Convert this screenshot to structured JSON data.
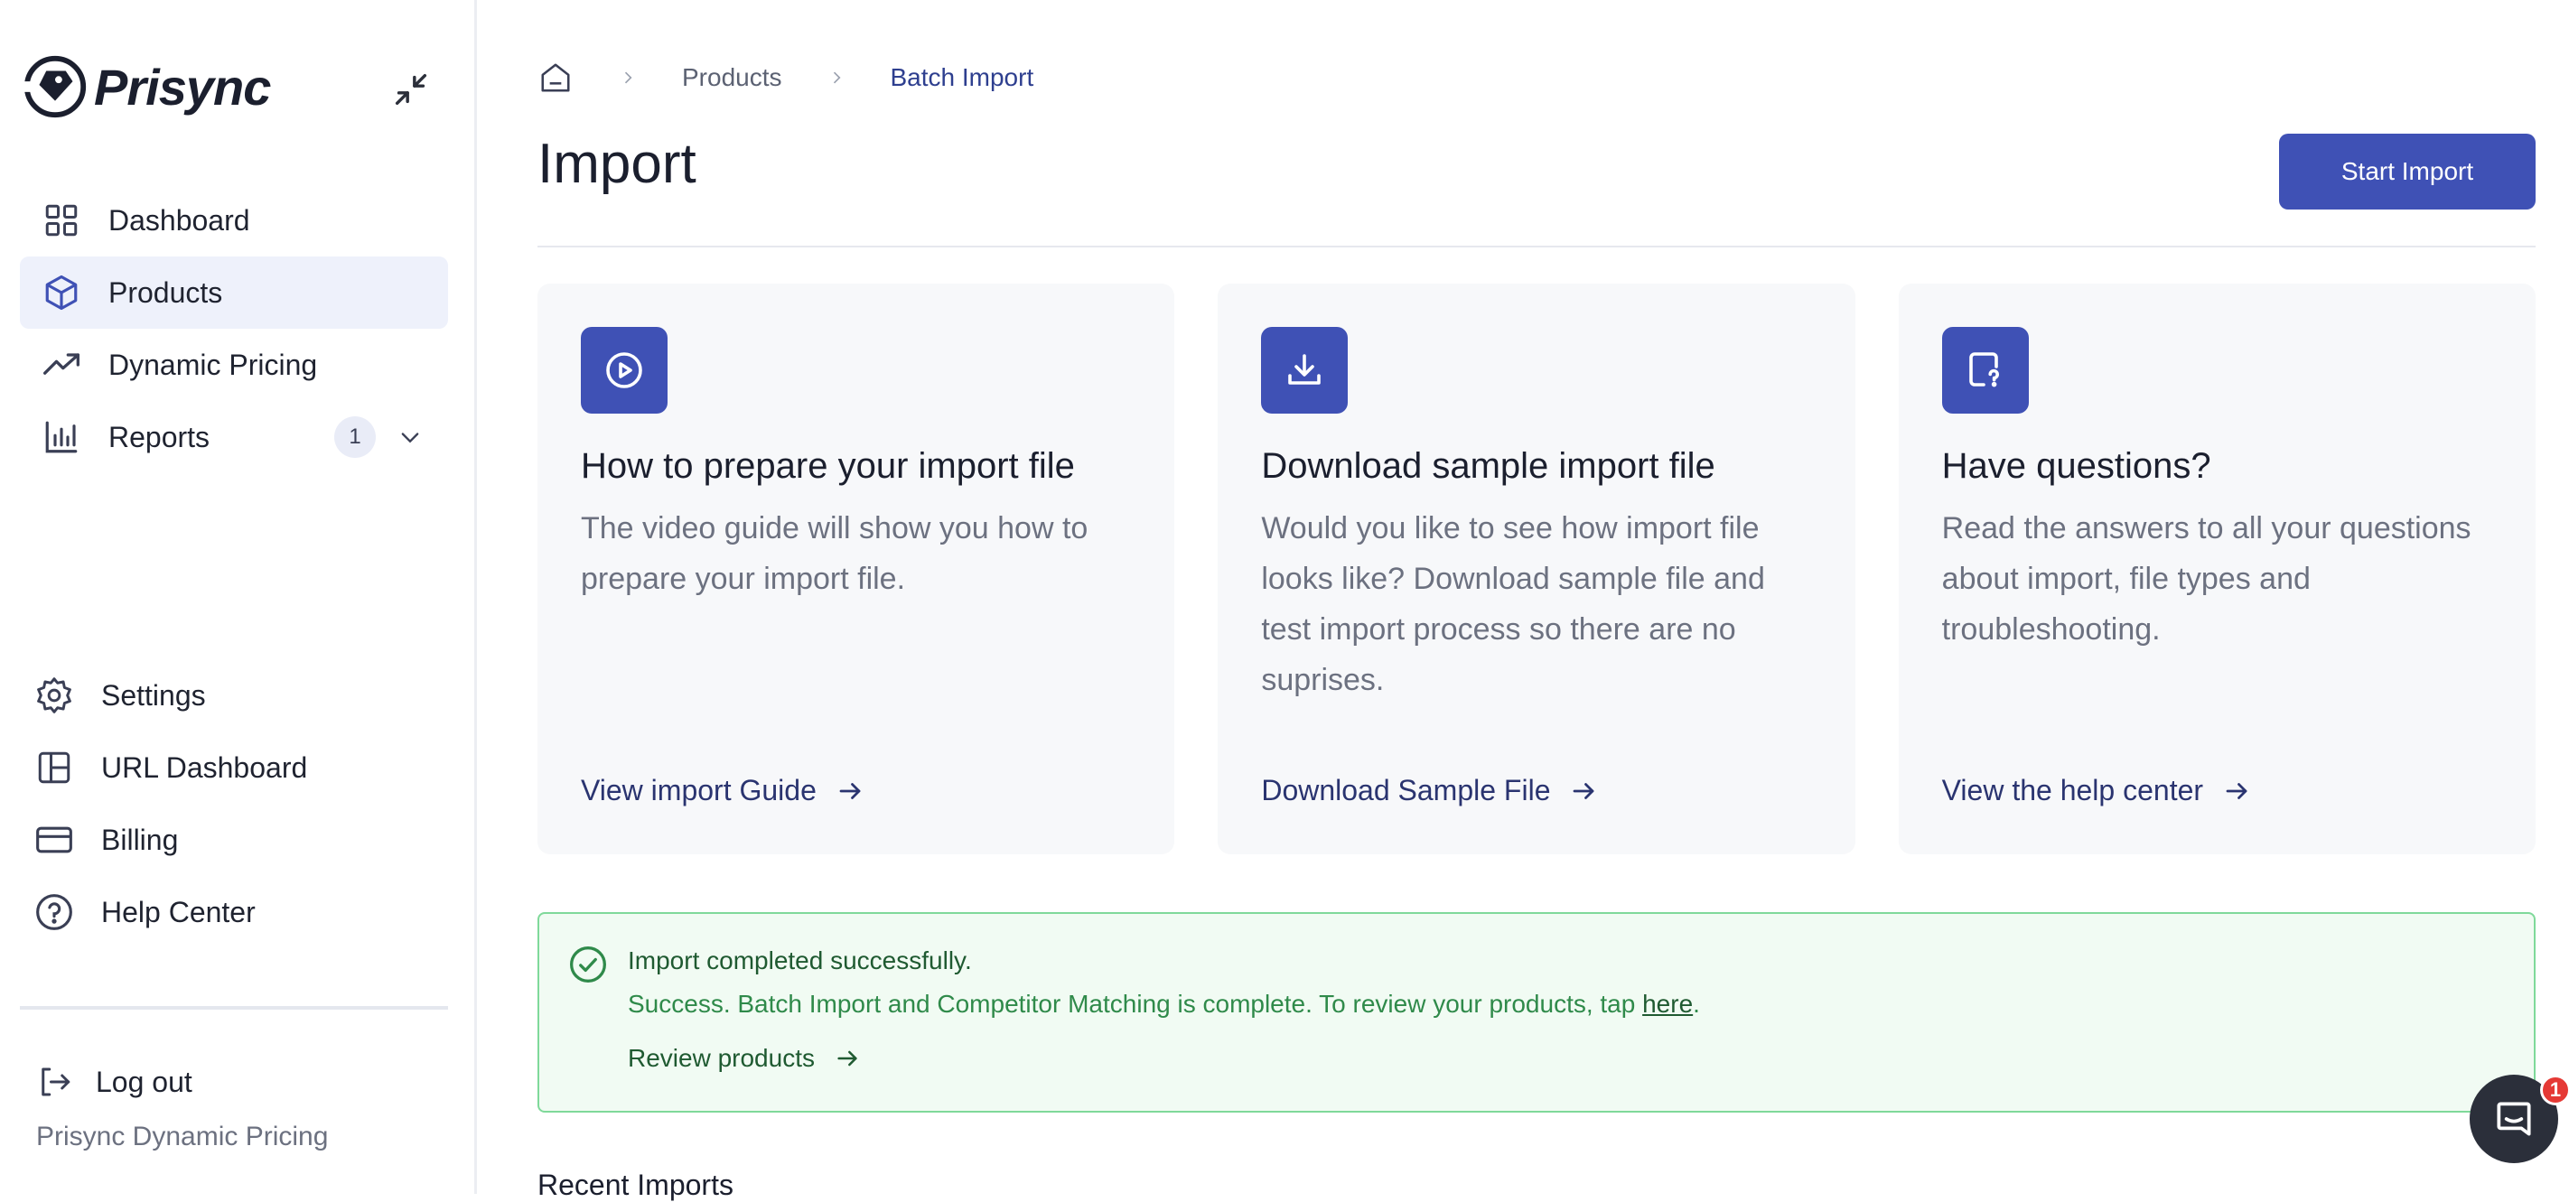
{
  "app": {
    "logo_text": "Prisync",
    "footer_name": "Prisync Dynamic Pricing"
  },
  "sidebar": {
    "collapse_icon": "collapse-icon",
    "items": [
      {
        "label": "Dashboard",
        "icon": "grid-icon",
        "active": false
      },
      {
        "label": "Products",
        "icon": "cube-icon",
        "active": true
      },
      {
        "label": "Dynamic Pricing",
        "icon": "trending-up-icon",
        "active": false
      },
      {
        "label": "Reports",
        "icon": "bar-chart-icon",
        "active": false,
        "badge": "1"
      }
    ],
    "bottom_items": [
      {
        "label": "Settings",
        "icon": "gear-icon"
      },
      {
        "label": "URL Dashboard",
        "icon": "layout-icon"
      },
      {
        "label": "Billing",
        "icon": "credit-card-icon"
      },
      {
        "label": "Help Center",
        "icon": "help-circle-icon"
      }
    ],
    "logout_label": "Log out"
  },
  "breadcrumb": {
    "items": [
      "Products",
      "Batch Import"
    ]
  },
  "page": {
    "title": "Import",
    "start_button": "Start Import"
  },
  "cards": [
    {
      "icon": "play-circle-icon",
      "title": "How to prepare your import file",
      "description": "The video guide will show you how to prepare your import file.",
      "link": "View import Guide"
    },
    {
      "icon": "download-icon",
      "title": "Download sample import file",
      "description": "Would you like to see how import file looks like? Download sample file and test import process so there are no suprises.",
      "link": "Download Sample File"
    },
    {
      "icon": "help-file-icon",
      "title": "Have questions?",
      "description": "Read the answers to all your questions about import, file types and troubleshooting.",
      "link": "View the help center"
    }
  ],
  "alert": {
    "title": "Import completed successfully.",
    "body_prefix": "Success. Batch Import and Competitor Matching is complete. To review your products, tap ",
    "body_link": "here",
    "body_suffix": ".",
    "action": "Review products"
  },
  "recent_heading": "Recent Imports",
  "chat": {
    "badge": "1"
  },
  "colors": {
    "accent": "#3f51b5",
    "success_border": "#7fd99a",
    "success_bg": "#f1fbf3"
  }
}
